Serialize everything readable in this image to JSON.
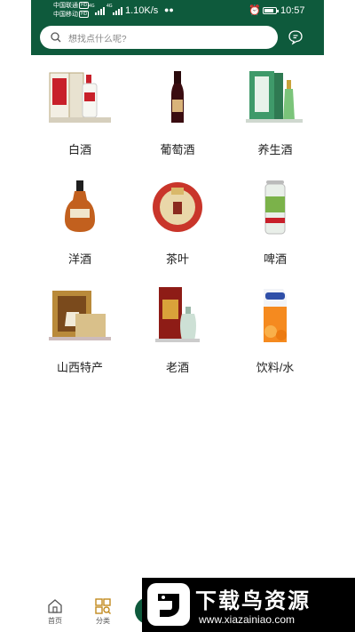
{
  "status_bar": {
    "carrier1": "中国联通",
    "carrier2": "中国移动",
    "hd": "HD",
    "gen1": "4G",
    "gen2": "4G",
    "speed": "1.10K/s",
    "time": "10:57",
    "battery_level": 0.85
  },
  "search": {
    "placeholder": "想找点什么呢?"
  },
  "categories": [
    {
      "label": "白酒",
      "icon": "baijiu-bottle-with-box-image"
    },
    {
      "label": "葡萄酒",
      "icon": "red-wine-bottle-image"
    },
    {
      "label": "养生酒",
      "icon": "green-health-wine-box-image"
    },
    {
      "label": "洋酒",
      "icon": "cognac-bottle-image"
    },
    {
      "label": "茶叶",
      "icon": "tea-cake-image"
    },
    {
      "label": "啤酒",
      "icon": "beer-can-image"
    },
    {
      "label": "山西特产",
      "icon": "shanxi-specialty-box-image"
    },
    {
      "label": "老酒",
      "icon": "old-liquor-box-image"
    },
    {
      "label": "饮料/水",
      "icon": "juice-carton-image"
    }
  ],
  "tabbar": {
    "home": "首页",
    "category": "分类"
  },
  "watermark": {
    "title": "下载鸟资源",
    "url": "www.xiazainiao.com"
  },
  "colors": {
    "brand_green": "#0e5a3c"
  }
}
